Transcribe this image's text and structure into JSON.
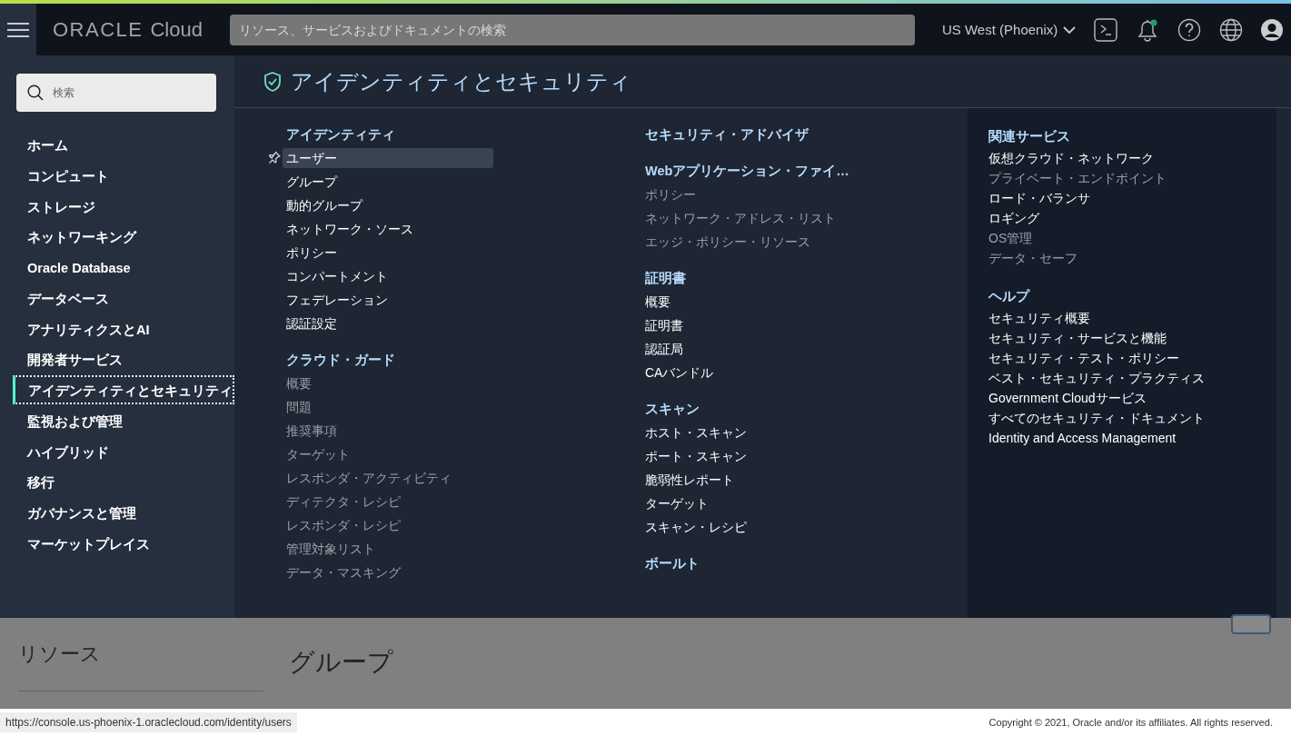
{
  "topbar": {
    "brand": "ORACLE",
    "brand_suffix": "Cloud",
    "search": {
      "placeholder": "リソース、サービスおよびドキュメントの検索"
    },
    "region": "US West (Phoenix)"
  },
  "sidebar": {
    "search": {
      "placeholder": "検索"
    },
    "items": [
      {
        "label": "ホーム",
        "selected": false
      },
      {
        "label": "コンピュート",
        "selected": false
      },
      {
        "label": "ストレージ",
        "selected": false
      },
      {
        "label": "ネットワーキング",
        "selected": false
      },
      {
        "label": "Oracle Database",
        "selected": false
      },
      {
        "label": "データベース",
        "selected": false
      },
      {
        "label": "アナリティクスとAI",
        "selected": false
      },
      {
        "label": "開発者サービス",
        "selected": false
      },
      {
        "label": "アイデンティティとセキュリティ",
        "selected": true
      },
      {
        "label": "監視および管理",
        "selected": false
      },
      {
        "label": "ハイブリッド",
        "selected": false
      },
      {
        "label": "移行",
        "selected": false
      },
      {
        "label": "ガバナンスと管理",
        "selected": false
      },
      {
        "label": "マーケットプレイス",
        "selected": false
      }
    ]
  },
  "menu": {
    "title": "アイデンティティとセキュリティ",
    "columns": [
      {
        "kind": "wide",
        "sections": [
          {
            "heading": "アイデンティティ",
            "items": [
              {
                "label": "ユーザー",
                "selected": true,
                "dimmed": false
              },
              {
                "label": "グループ",
                "selected": false,
                "dimmed": false
              },
              {
                "label": "動的グループ",
                "selected": false,
                "dimmed": false
              },
              {
                "label": "ネットワーク・ソース",
                "selected": false,
                "dimmed": false
              },
              {
                "label": "ポリシー",
                "selected": false,
                "dimmed": false
              },
              {
                "label": "コンパートメント",
                "selected": false,
                "dimmed": false
              },
              {
                "label": "フェデレーション",
                "selected": false,
                "dimmed": false
              },
              {
                "label": "認証設定",
                "selected": false,
                "dimmed": false
              }
            ]
          },
          {
            "heading": "クラウド・ガード",
            "items": [
              {
                "label": "概要",
                "selected": false,
                "dimmed": true
              },
              {
                "label": "問題",
                "selected": false,
                "dimmed": true
              },
              {
                "label": "推奨事項",
                "selected": false,
                "dimmed": true
              },
              {
                "label": "ターゲット",
                "selected": false,
                "dimmed": true
              },
              {
                "label": "レスポンダ・アクティビティ",
                "selected": false,
                "dimmed": true
              },
              {
                "label": "ディテクタ・レシピ",
                "selected": false,
                "dimmed": true
              },
              {
                "label": "レスポンダ・レシピ",
                "selected": false,
                "dimmed": true
              },
              {
                "label": "管理対象リスト",
                "selected": false,
                "dimmed": true
              },
              {
                "label": "データ・マスキング",
                "selected": false,
                "dimmed": true
              }
            ]
          }
        ]
      },
      {
        "kind": "wide",
        "sections": [
          {
            "heading": "セキュリティ・アドバイザ"
          },
          {
            "heading": "Webアプリケーション・ファイ…",
            "items": [
              {
                "label": "ポリシー",
                "selected": false,
                "dimmed": true
              },
              {
                "label": "ネットワーク・アドレス・リスト",
                "selected": false,
                "dimmed": true
              },
              {
                "label": "エッジ・ポリシー・リソース",
                "selected": false,
                "dimmed": true
              }
            ]
          },
          {
            "heading": "証明書",
            "items": [
              {
                "label": "概要",
                "selected": false,
                "dimmed": false
              },
              {
                "label": "証明書",
                "selected": false,
                "dimmed": false
              },
              {
                "label": "認証局",
                "selected": false,
                "dimmed": false
              },
              {
                "label": "CAバンドル",
                "selected": false,
                "dimmed": false
              }
            ]
          },
          {
            "heading": "スキャン",
            "items": [
              {
                "label": "ホスト・スキャン",
                "selected": false,
                "dimmed": false
              },
              {
                "label": "ポート・スキャン",
                "selected": false,
                "dimmed": false
              },
              {
                "label": "脆弱性レポート",
                "selected": false,
                "dimmed": false
              },
              {
                "label": "ターゲット",
                "selected": false,
                "dimmed": false
              },
              {
                "label": "スキャン・レシピ",
                "selected": false,
                "dimmed": false
              }
            ]
          },
          {
            "heading": "ボールト"
          }
        ]
      },
      {
        "kind": "compact",
        "sections": [
          {
            "heading": "関連サービス",
            "items": [
              {
                "label": "仮想クラウド・ネットワーク",
                "selected": false,
                "dimmed": false
              },
              {
                "label": "プライベート・エンドポイント",
                "selected": false,
                "dimmed": true
              },
              {
                "label": "ロード・バランサ",
                "selected": false,
                "dimmed": false
              },
              {
                "label": "ロギング",
                "selected": false,
                "dimmed": false
              },
              {
                "label": "OS管理",
                "selected": false,
                "dimmed": true
              },
              {
                "label": "データ・セーフ",
                "selected": false,
                "dimmed": true
              }
            ]
          },
          {
            "heading": "ヘルプ",
            "items": [
              {
                "label": "セキュリティ概要",
                "selected": false,
                "dimmed": false
              },
              {
                "label": "セキュリティ・サービスと機能",
                "selected": false,
                "dimmed": false
              },
              {
                "label": "セキュリティ・テスト・ポリシー",
                "selected": false,
                "dimmed": false
              },
              {
                "label": "ベスト・セキュリティ・プラクティス",
                "selected": false,
                "dimmed": false
              },
              {
                "label": "Government Cloudサービス",
                "selected": false,
                "dimmed": false
              },
              {
                "label": "すべてのセキュリティ・ドキュメント",
                "selected": false,
                "dimmed": false
              },
              {
                "label": "Identity and Access Management",
                "selected": false,
                "dimmed": false
              }
            ]
          }
        ]
      }
    ]
  },
  "background_page": {
    "sidebar_title": "リソース",
    "title": "グループ"
  },
  "status_bar": {
    "url": "https://console.us-phoenix-1.oraclecloud.com/identity/users",
    "copyright": "Copyright © 2021, Oracle and/or its affiliates. All rights reserved."
  }
}
